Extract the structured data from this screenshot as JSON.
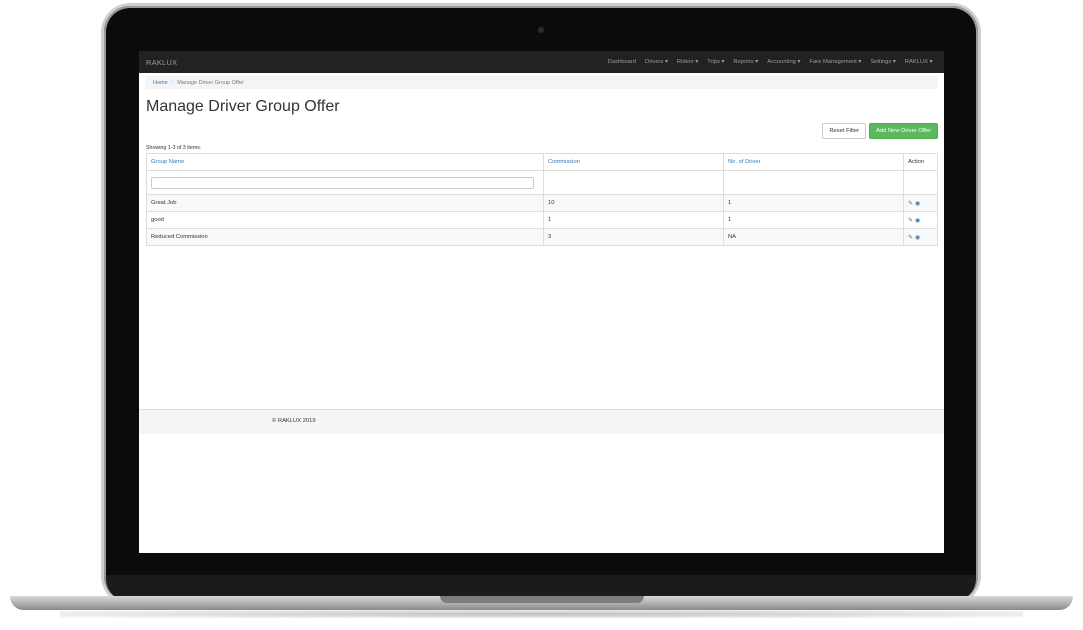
{
  "navbar": {
    "brand": "RAKLUX",
    "items": [
      {
        "label": "Dashboard"
      },
      {
        "label": "Drivers ▾"
      },
      {
        "label": "Riders ▾"
      },
      {
        "label": "Trips ▾"
      },
      {
        "label": "Reports ▾"
      },
      {
        "label": "Accounting ▾"
      },
      {
        "label": "Fare Management ▾"
      },
      {
        "label": "Settings ▾"
      },
      {
        "label": "RAKLUX ▾"
      }
    ]
  },
  "breadcrumb": {
    "home": "Home",
    "separator": "/",
    "current": "Manage Driver Group Offer"
  },
  "page": {
    "title": "Manage Driver Group Offer",
    "reset_label": "Reset Filter",
    "add_label": "Add New Driver Offer",
    "summary": "Showing 1-3 of 3 items."
  },
  "table": {
    "headers": {
      "group_name": "Group Name",
      "commission": "Commission",
      "drivers": "No. of Driver",
      "action": "Action"
    },
    "rows": [
      {
        "group_name": "Great Job",
        "commission": "10",
        "drivers": "1"
      },
      {
        "group_name": "good",
        "commission": "1",
        "drivers": "1"
      },
      {
        "group_name": "Reduced Commission",
        "commission": "3",
        "drivers": "NA"
      }
    ],
    "icons": {
      "edit": "pencil-icon",
      "view": "eye-icon"
    }
  },
  "footer": {
    "copyright": "© RAKLUX 2019"
  },
  "colors": {
    "navbar": "#222222",
    "link": "#337ab7",
    "success": "#5cb85c"
  }
}
